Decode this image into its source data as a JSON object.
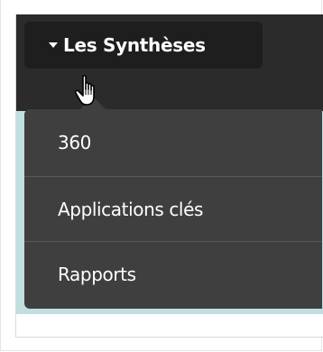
{
  "menu": {
    "button_label": "Les Synthèses",
    "items": [
      {
        "label": "360"
      },
      {
        "label": "Applications clés"
      },
      {
        "label": "Rapports"
      }
    ]
  },
  "colors": {
    "topbar": "#2b2b2b",
    "button": "#1e1e1e",
    "dropdown": "#3f3f3f",
    "band": "#bfdfe0"
  },
  "icons": {
    "caret": "caret-down-icon",
    "cursor": "hand-pointer-icon"
  }
}
